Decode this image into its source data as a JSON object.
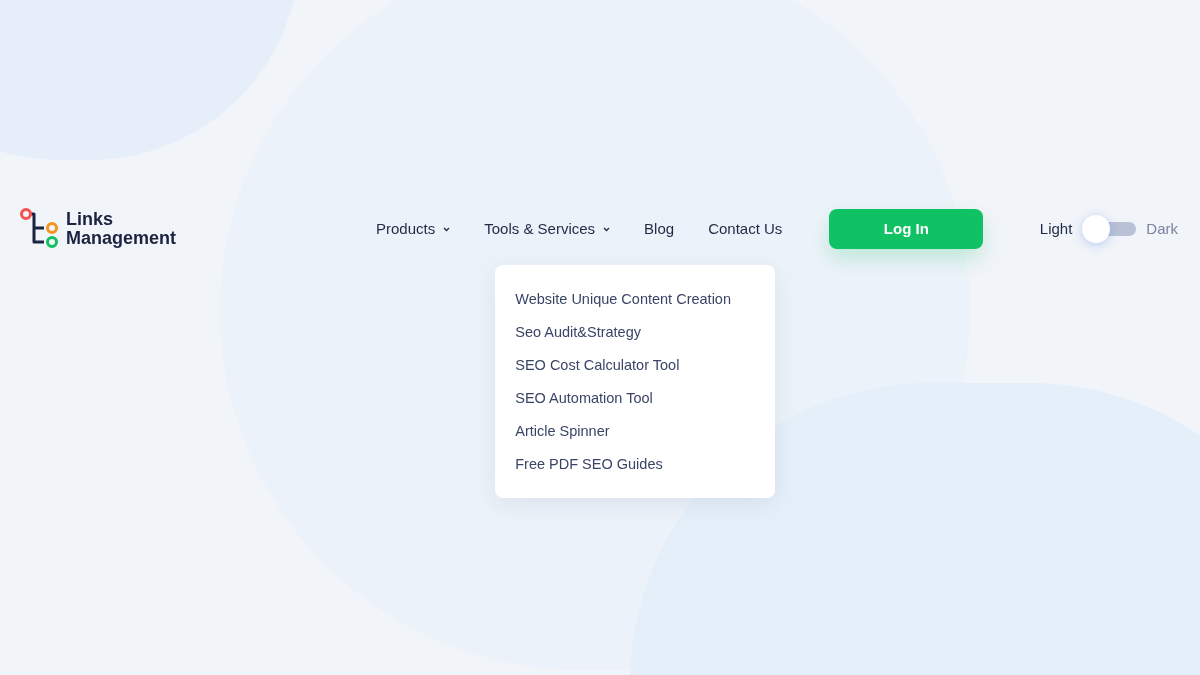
{
  "logo": {
    "line_1": "Links",
    "line_2": "Management"
  },
  "nav": [
    {
      "label": "Products",
      "kind": "dropdown"
    },
    {
      "label": "Tools & Services",
      "kind": "dropdown",
      "menu": [
        "Website Unique Content Creation",
        "Seo Audit&Strategy",
        "SEO Cost Calculator Tool",
        "SEO Automation Tool",
        "Article Spinner",
        "Free PDF SEO Guides"
      ]
    },
    {
      "label": "Blog",
      "kind": "link"
    },
    {
      "label": "Contact Us",
      "kind": "link"
    }
  ],
  "login_button": "Log In",
  "theme": {
    "light_label": "Light",
    "dark_label": "Dark",
    "dark": false
  }
}
